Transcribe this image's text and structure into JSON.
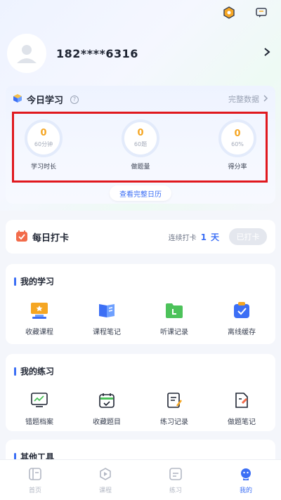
{
  "header": {
    "icons": [
      "hexagon-badge-icon",
      "message-icon"
    ]
  },
  "profile": {
    "phone": "182****6316",
    "avatar_icon": "user-avatar-icon"
  },
  "today": {
    "title": "今日学习",
    "full_data_label": "完整数据",
    "stats": [
      {
        "value": "0",
        "sub": "60分钟",
        "label": "学习时长"
      },
      {
        "value": "0",
        "sub": "60题",
        "label": "做题量"
      },
      {
        "value": "0",
        "sub": "60%",
        "label": "得分率"
      }
    ],
    "calendar_button": "查看完整日历"
  },
  "checkin": {
    "title": "每日打卡",
    "streak_prefix": "连续打卡",
    "streak_count": "1",
    "streak_unit": "天",
    "button": "已打卡"
  },
  "my_study": {
    "title": "我的学习",
    "items": [
      {
        "label": "收藏课程",
        "icon": "favorite-course-icon"
      },
      {
        "label": "课程笔记",
        "icon": "course-notes-icon"
      },
      {
        "label": "听课记录",
        "icon": "listen-record-icon"
      },
      {
        "label": "离线缓存",
        "icon": "offline-cache-icon"
      }
    ]
  },
  "my_practice": {
    "title": "我的练习",
    "items": [
      {
        "label": "错题档案",
        "icon": "wrong-questions-icon"
      },
      {
        "label": "收藏题目",
        "icon": "favorite-questions-icon"
      },
      {
        "label": "练习记录",
        "icon": "practice-record-icon"
      },
      {
        "label": "做题笔记",
        "icon": "question-notes-icon"
      }
    ]
  },
  "other_tools": {
    "title": "其他工具"
  },
  "tabbar": {
    "tabs": [
      {
        "label": "首页",
        "icon": "home-icon"
      },
      {
        "label": "课程",
        "icon": "course-play-icon"
      },
      {
        "label": "练习",
        "icon": "practice-icon"
      },
      {
        "label": "我的",
        "icon": "profile-icon",
        "active": true
      }
    ]
  },
  "colors": {
    "accent": "#3c6ff5",
    "stat_value": "#f5a623",
    "highlight_border": "#e0181e"
  }
}
